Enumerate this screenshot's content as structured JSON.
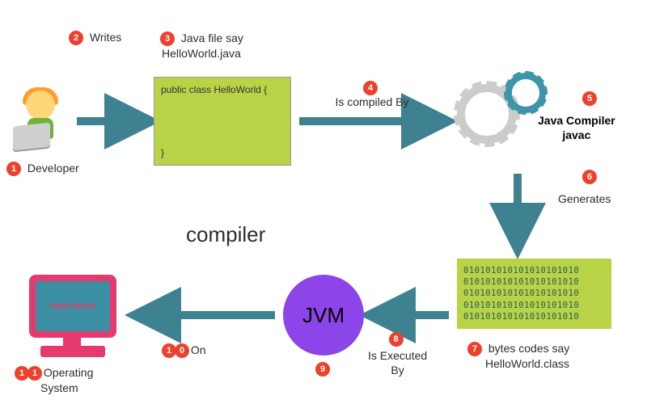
{
  "steps": {
    "n1": "Developer",
    "n2": "Writes",
    "n3_line1": "Java file say",
    "n3_line2": "HelloWorld.java",
    "n4": "Is compiled By",
    "n5_line1": "Java Compiler",
    "n5_line2": "javac",
    "n6": "Generates",
    "n7_line1": "bytes codes say",
    "n7_line2": "HelloWorld.class",
    "n8_line1": "Is Executed",
    "n8_line2": "By",
    "n9": "",
    "n10": "On",
    "n11_line1": "Operating",
    "n11_line2": "System"
  },
  "badges": {
    "b1": "1",
    "b2": "2",
    "b3": "3",
    "b4": "4",
    "b5": "5",
    "b6": "6",
    "b7": "7",
    "b8": "8",
    "b9": "9",
    "b10a": "1",
    "b10b": "0",
    "b11a": "1",
    "b11b": "1"
  },
  "title": "compiler",
  "codebox": {
    "line1": "public class HelloWorld {",
    "line2": "}"
  },
  "bytecode": "010101010101010101010\n010101010101010101010\n010101010101010101010\n010101010101010101010\n010101010101010101010",
  "jvm_label": "JVM",
  "screen_text": "Hello World",
  "colors": {
    "arrow": "#3E8291",
    "badge": "#ED412D",
    "lime": "#B8D346",
    "jvm": "#8C45E8"
  }
}
